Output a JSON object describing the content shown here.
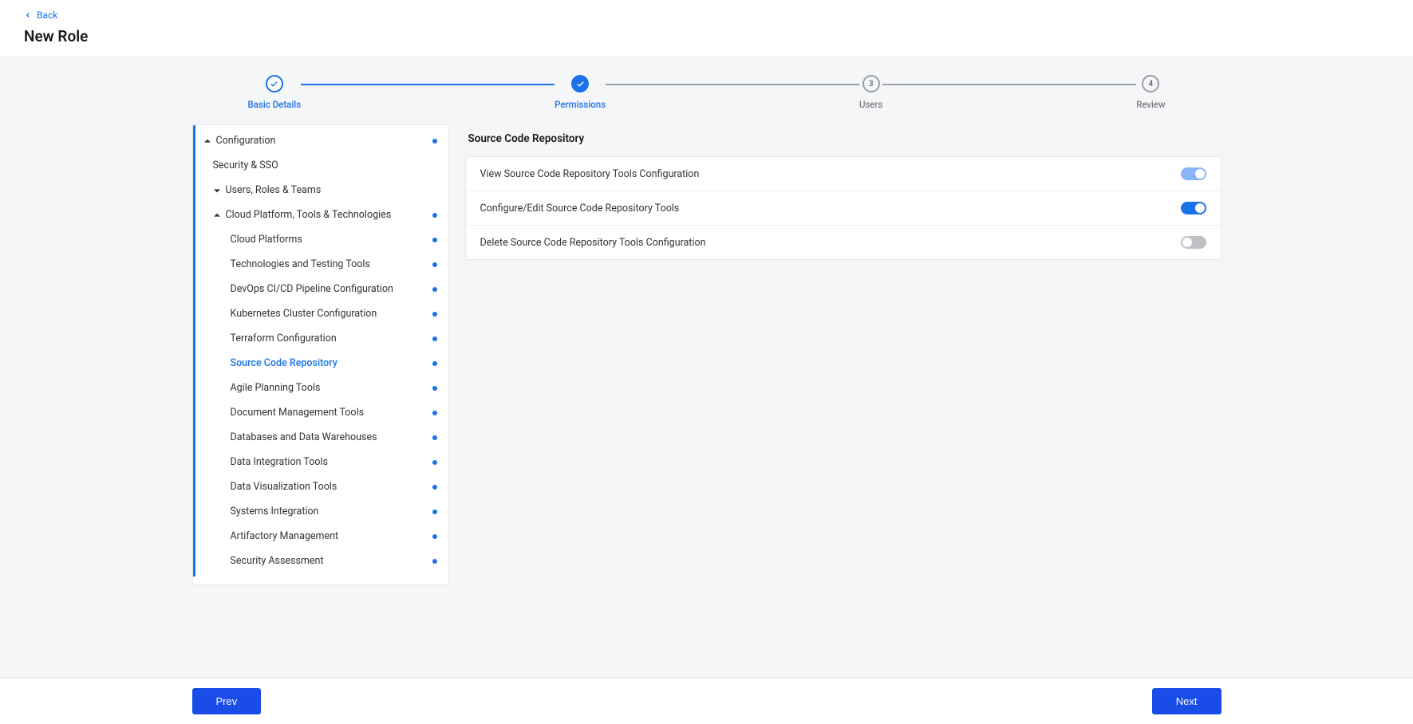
{
  "header": {
    "back_label": "Back",
    "title": "New Role"
  },
  "stepper": {
    "steps": [
      {
        "label": "Basic Details",
        "state": "done"
      },
      {
        "label": "Permissions",
        "state": "active"
      },
      {
        "label": "Users",
        "state": "pending",
        "num": "3"
      },
      {
        "label": "Review",
        "state": "pending",
        "num": "4"
      }
    ]
  },
  "sidebar": {
    "tree": [
      {
        "label": "Configuration",
        "level": 0,
        "expanded": true,
        "has_dot": true,
        "type": "group"
      },
      {
        "label": "Security & SSO",
        "level": 1,
        "type": "leaf"
      },
      {
        "label": "Users, Roles & Teams",
        "level": 1,
        "expanded": false,
        "type": "group"
      },
      {
        "label": "Cloud Platform, Tools & Technologies",
        "level": 1,
        "expanded": true,
        "has_dot": true,
        "type": "group"
      },
      {
        "label": "Cloud Platforms",
        "level": 2,
        "has_dot": true,
        "type": "leaf"
      },
      {
        "label": "Technologies and Testing Tools",
        "level": 2,
        "has_dot": true,
        "type": "leaf"
      },
      {
        "label": "DevOps CI/CD Pipeline Configuration",
        "level": 2,
        "has_dot": true,
        "type": "leaf"
      },
      {
        "label": "Kubernetes Cluster Configuration",
        "level": 2,
        "has_dot": true,
        "type": "leaf"
      },
      {
        "label": "Terraform Configuration",
        "level": 2,
        "has_dot": true,
        "type": "leaf"
      },
      {
        "label": "Source Code Repository",
        "level": 2,
        "has_dot": true,
        "type": "leaf",
        "active": true
      },
      {
        "label": "Agile Planning Tools",
        "level": 2,
        "has_dot": true,
        "type": "leaf"
      },
      {
        "label": "Document Management Tools",
        "level": 2,
        "has_dot": true,
        "type": "leaf"
      },
      {
        "label": "Databases and Data Warehouses",
        "level": 2,
        "has_dot": true,
        "type": "leaf"
      },
      {
        "label": "Data Integration Tools",
        "level": 2,
        "has_dot": true,
        "type": "leaf"
      },
      {
        "label": "Data Visualization Tools",
        "level": 2,
        "has_dot": true,
        "type": "leaf"
      },
      {
        "label": "Systems Integration",
        "level": 2,
        "has_dot": true,
        "type": "leaf"
      },
      {
        "label": "Artifactory Management",
        "level": 2,
        "has_dot": true,
        "type": "leaf"
      },
      {
        "label": "Security Assessment",
        "level": 2,
        "has_dot": true,
        "type": "leaf"
      }
    ]
  },
  "main": {
    "section_title": "Source Code Repository",
    "permissions": [
      {
        "label": "View Source Code Repository Tools Configuration",
        "state": "on-light"
      },
      {
        "label": "Configure/Edit Source Code Repository Tools",
        "state": "on"
      },
      {
        "label": "Delete Source Code Repository Tools Configuration",
        "state": "off"
      }
    ]
  },
  "footer": {
    "prev_label": "Prev",
    "next_label": "Next"
  }
}
